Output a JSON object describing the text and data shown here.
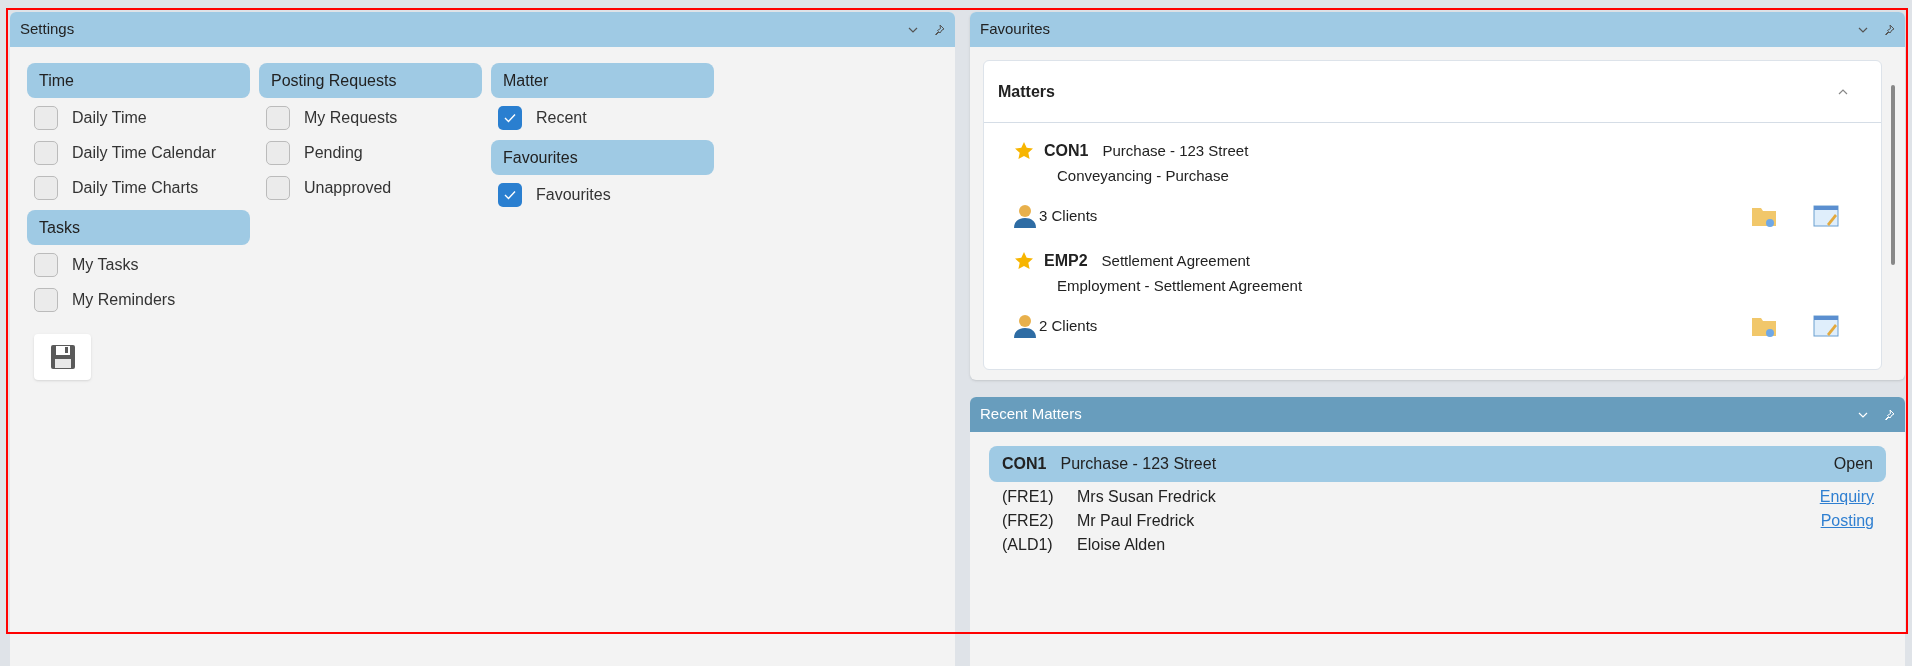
{
  "settings": {
    "title": "Settings",
    "columns": [
      [
        {
          "title": "Time",
          "items": [
            {
              "label": "Daily Time",
              "checked": false
            },
            {
              "label": "Daily Time Calendar",
              "checked": false
            },
            {
              "label": "Daily Time Charts",
              "checked": false
            }
          ]
        },
        {
          "title": "Tasks",
          "items": [
            {
              "label": "My Tasks",
              "checked": false
            },
            {
              "label": "My Reminders",
              "checked": false
            }
          ]
        }
      ],
      [
        {
          "title": "Posting Requests",
          "items": [
            {
              "label": "My Requests",
              "checked": false
            },
            {
              "label": "Pending",
              "checked": false
            },
            {
              "label": "Unapproved",
              "checked": false
            }
          ]
        }
      ],
      [
        {
          "title": "Matter",
          "items": [
            {
              "label": "Recent",
              "checked": true
            }
          ]
        },
        {
          "title": "Favourites",
          "items": [
            {
              "label": "Favourites",
              "checked": true
            }
          ]
        }
      ]
    ]
  },
  "favourites": {
    "title": "Favourites",
    "section": {
      "title": "Matters",
      "expanded": true,
      "matters": [
        {
          "code": "CON1",
          "name": "Purchase - 123 Street",
          "type": "Conveyancing - Purchase",
          "clients": "3 Clients"
        },
        {
          "code": "EMP2",
          "name": "Settlement Agreement",
          "type": "Employment - Settlement Agreement",
          "clients": "2 Clients"
        }
      ]
    }
  },
  "recent_matters": {
    "title": "Recent Matters",
    "matter": {
      "code": "CON1",
      "name": "Purchase - 123 Street",
      "status": "Open"
    },
    "clients": [
      {
        "ref": "(FRE1)",
        "name": "Mrs Susan Fredrick",
        "link": "Enquiry"
      },
      {
        "ref": "(FRE2)",
        "name": "Mr Paul Fredrick",
        "link": "Posting"
      },
      {
        "ref": "(ALD1)",
        "name": "Eloise Alden"
      }
    ]
  }
}
